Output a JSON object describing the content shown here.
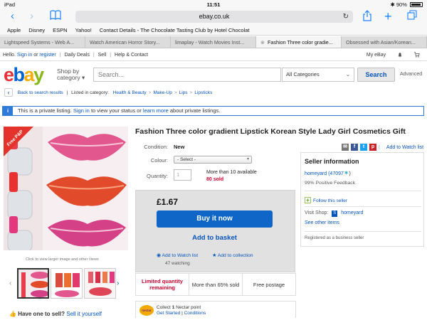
{
  "status_bar": {
    "device": "iPad",
    "time": "11:51",
    "battery": "90%"
  },
  "browser": {
    "url": "ebay.co.uk",
    "bookmarks": [
      "Apple",
      "Disney",
      "ESPN",
      "Yahoo!",
      "Contact Details - The Chocolate Tasting Club by Hotel Chocolat"
    ],
    "tabs": [
      {
        "label": "Lightspeed Systems - Web A...",
        "active": false
      },
      {
        "label": "Watch American Horror Story...",
        "active": false
      },
      {
        "label": "limaplay - Watch Movies Inst...",
        "active": false
      },
      {
        "label": "Fashion Three color gradie...",
        "active": true
      },
      {
        "label": "Obsessed with Asian/Korean...",
        "active": false
      }
    ]
  },
  "ebay_header": {
    "hello": "Hello.",
    "sign_in": "Sign in",
    "or": "or",
    "register": "register",
    "daily_deals": "Daily Deals",
    "sell": "Sell",
    "help": "Help & Contact",
    "my_ebay": "My eBay"
  },
  "search": {
    "shop_by_category": [
      "Shop by",
      "category"
    ],
    "placeholder": "Search...",
    "category": "All Categories",
    "button": "Search",
    "advanced": "Advanced"
  },
  "breadcrumb": {
    "back": "Back to search results",
    "listed_in": "Listed in category:",
    "path": [
      "Health & Beauty",
      "Make-Up",
      "Lips",
      "Lipsticks"
    ]
  },
  "notice": {
    "pre": "This is a private listing.",
    "sign_in": "Sign in",
    "mid": "to view your status or",
    "learn_more": "learn more",
    "post": "about private listings."
  },
  "gallery": {
    "badge": "Free P&P",
    "caption": "Click to view larger image and other views"
  },
  "sell_prompt": {
    "text": "Have one to sell?",
    "link": "Sell it yourself"
  },
  "item": {
    "title": "Fashion Three color gradient Lipstick Korean Style Lady Girl Cosmetics Gift",
    "condition_label": "Condition:",
    "condition": "New",
    "colour_label": "Colour:",
    "colour_selected": "- Select -",
    "quantity_label": "Quantity:",
    "quantity_value": "1",
    "available": "More than 10 available",
    "sold": "80 sold",
    "price": "£1.67",
    "buy_now": "Buy it now",
    "add_to_basket": "Add to basket",
    "add_to_watch": "Add to Watch list",
    "add_to_collection": "Add to collection",
    "watching": "47 watching",
    "add_to_watch_list_top": "Add to Watch list",
    "stats": [
      {
        "text": "Limited quantity remaining",
        "highlight": true
      },
      {
        "text": "More than 65% sold",
        "highlight": false
      },
      {
        "text": "Free postage",
        "highlight": false
      }
    ],
    "nectar": {
      "logo": "nectar",
      "collect": "Collect",
      "points": "1",
      "points_label": "Nectar point",
      "get_started": "Get Started",
      "conditions": "Conditions"
    }
  },
  "seller": {
    "heading": "Seller information",
    "name": "homeyard",
    "feedback_score": "(47097",
    "positive": "99% Positive Feedback",
    "follow": "Follow this seller",
    "visit_shop": "Visit Shop:",
    "shop_name": "homeyard",
    "other_items": "See other items",
    "registered": "Registered as a business seller"
  },
  "colors": {
    "ebay_red": "#e53238",
    "ebay_blue": "#0064d2",
    "ebay_yellow": "#f5af02",
    "ebay_green": "#86b817",
    "link": "#0654ba",
    "buy_button": "#0f66c6",
    "alert_red": "#c6002c",
    "ios_blue": "#1a82fb"
  }
}
